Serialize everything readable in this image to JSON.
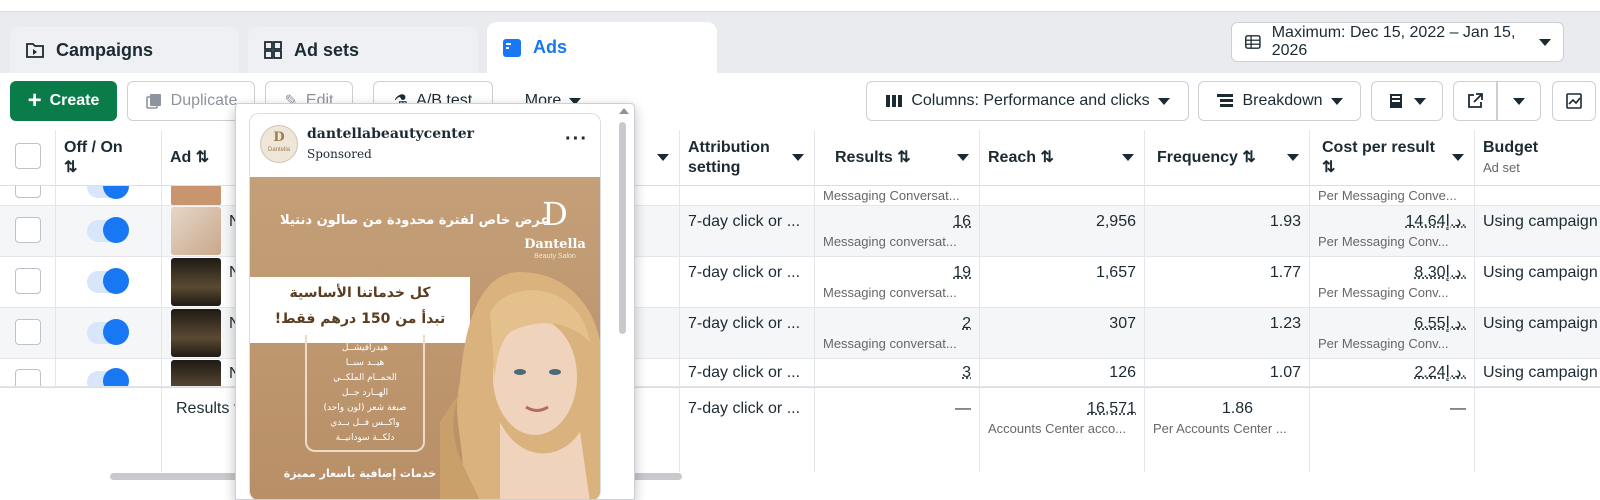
{
  "tabs": [
    {
      "label": "Campaigns",
      "icon": "folder-icon"
    },
    {
      "label": "Ad sets",
      "icon": "grid-icon"
    },
    {
      "label": "Ads",
      "icon": "ad-icon"
    }
  ],
  "date_range": "Maximum: Dec 15, 2022 – Jan 15, 2026",
  "toolbar": {
    "create": "Create",
    "duplicate": "Duplicate",
    "edit": "Edit",
    "ab_test": "A/B test",
    "more": "More",
    "columns": "Columns: Performance and clicks",
    "breakdown": "Breakdown"
  },
  "headers": {
    "off_on": "Off / On",
    "ad": "Ad",
    "attribution": "Attribution setting",
    "results": "Results",
    "reach": "Reach",
    "frequency": "Frequency",
    "cost_per_result": "Cost per result",
    "budget": "Budget",
    "budget_sub": "Ad set"
  },
  "partial_row": {
    "results_sub": "Messaging Conversat...",
    "cost_sub": "Per Messaging Conve..."
  },
  "rows": [
    {
      "ad_initial": "N",
      "attribution": "7-day click or ...",
      "results": "16",
      "results_sub": "Messaging conversat...",
      "reach": "2,956",
      "frequency": "1.93",
      "cost": "14.64د.إ.",
      "cost_sub": "Per Messaging Conv...",
      "budget": "Using campaign"
    },
    {
      "ad_initial": "N",
      "attribution": "7-day click or ...",
      "results": "19",
      "results_sub": "Messaging conversat...",
      "reach": "1,657",
      "frequency": "1.77",
      "cost": "8.30د.إ.",
      "cost_sub": "Per Messaging Conv...",
      "budget": "Using campaign"
    },
    {
      "ad_initial": "N",
      "attribution": "7-day click or ...",
      "results": "2",
      "results_sub": "Messaging conversat...",
      "reach": "307",
      "frequency": "1.23",
      "cost": "6.55د.إ.",
      "cost_sub": "Per Messaging Conv...",
      "budget": "Using campaign"
    },
    {
      "ad_initial": "N",
      "attribution": "7-day click or ...",
      "results": "3",
      "results_sub": "",
      "reach": "126",
      "frequency": "1.07",
      "cost": "2.24د.إ.",
      "cost_sub": "",
      "budget": "Using campaign"
    }
  ],
  "summary": {
    "label": "Results f",
    "attribution": "7-day click or ...",
    "results": "—",
    "reach": "16,571",
    "reach_sub": "Accounts Center acco...",
    "frequency": "1.86",
    "frequency_sub": "Per Accounts Center ...",
    "cost": "—"
  },
  "preview": {
    "page_name": "dantellabeautycenter",
    "sponsored": "Sponsored",
    "more": "···",
    "avatar_text": "Dantella",
    "offer_banner": "عرض خاص لفترة محدودة من صالون دنتيلا",
    "brand": "Dantella",
    "brand_sub": "Beauty Salon",
    "headline_1": "كل خدماتنا الأساسية",
    "headline_2": "تبدأ من 150 درهم فقط!",
    "services": [
      "هيدرافيشــل",
      "هيــد سبــا",
      "الحمــام الملكــي",
      "الهــارد جــل",
      "صبغة شعر (لون واحد)",
      "واكــس فــل بــدي",
      "دلكــة سودانيــة"
    ],
    "footer": "خدمات إضافية بأسعار مميزة"
  },
  "colors": {
    "accent": "#1877f2",
    "create_green": "#0a7c4a",
    "ad_bg": "#c49f78"
  }
}
